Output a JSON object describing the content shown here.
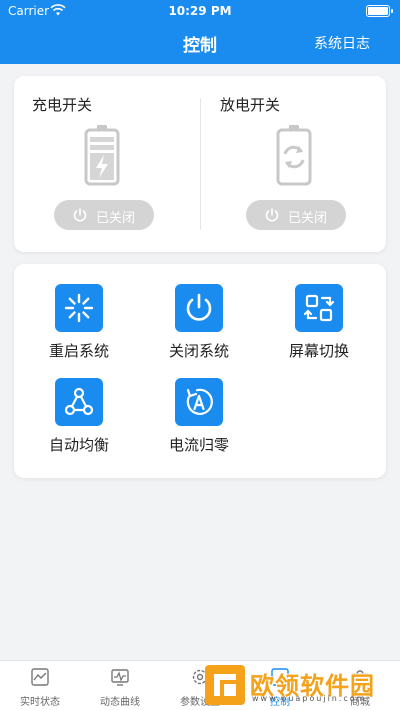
{
  "status_bar": {
    "carrier": "Carrier",
    "time": "10:29 PM"
  },
  "nav": {
    "title": "控制",
    "right_link": "系统日志"
  },
  "switches": {
    "charge": {
      "label": "充电开关",
      "button_label": "已关闭"
    },
    "discharge": {
      "label": "放电开关",
      "button_label": "已关闭"
    }
  },
  "grid": [
    {
      "label": "重启系统",
      "icon": "restart-icon"
    },
    {
      "label": "关闭系统",
      "icon": "power-icon"
    },
    {
      "label": "屏幕切换",
      "icon": "screen-switch-icon"
    },
    {
      "label": "自动均衡",
      "icon": "auto-balance-icon"
    },
    {
      "label": "电流归零",
      "icon": "current-reset-icon"
    }
  ],
  "tabs": [
    {
      "label": "实时状态",
      "icon": "realtime-icon",
      "active": false
    },
    {
      "label": "动态曲线",
      "icon": "curve-icon",
      "active": false
    },
    {
      "label": "参数设置",
      "icon": "settings-icon",
      "active": false
    },
    {
      "label": "控制",
      "icon": "control-icon",
      "active": true
    },
    {
      "label": "商城",
      "icon": "shop-icon",
      "active": false
    }
  ],
  "watermark": {
    "text": "欧领软件园",
    "sub": "www.ouapoujin.com"
  },
  "colors": {
    "primary": "#1a8cf0",
    "disabled": "#d4d4d4",
    "background": "#f2f3f5",
    "watermark": "#f4a21a"
  }
}
